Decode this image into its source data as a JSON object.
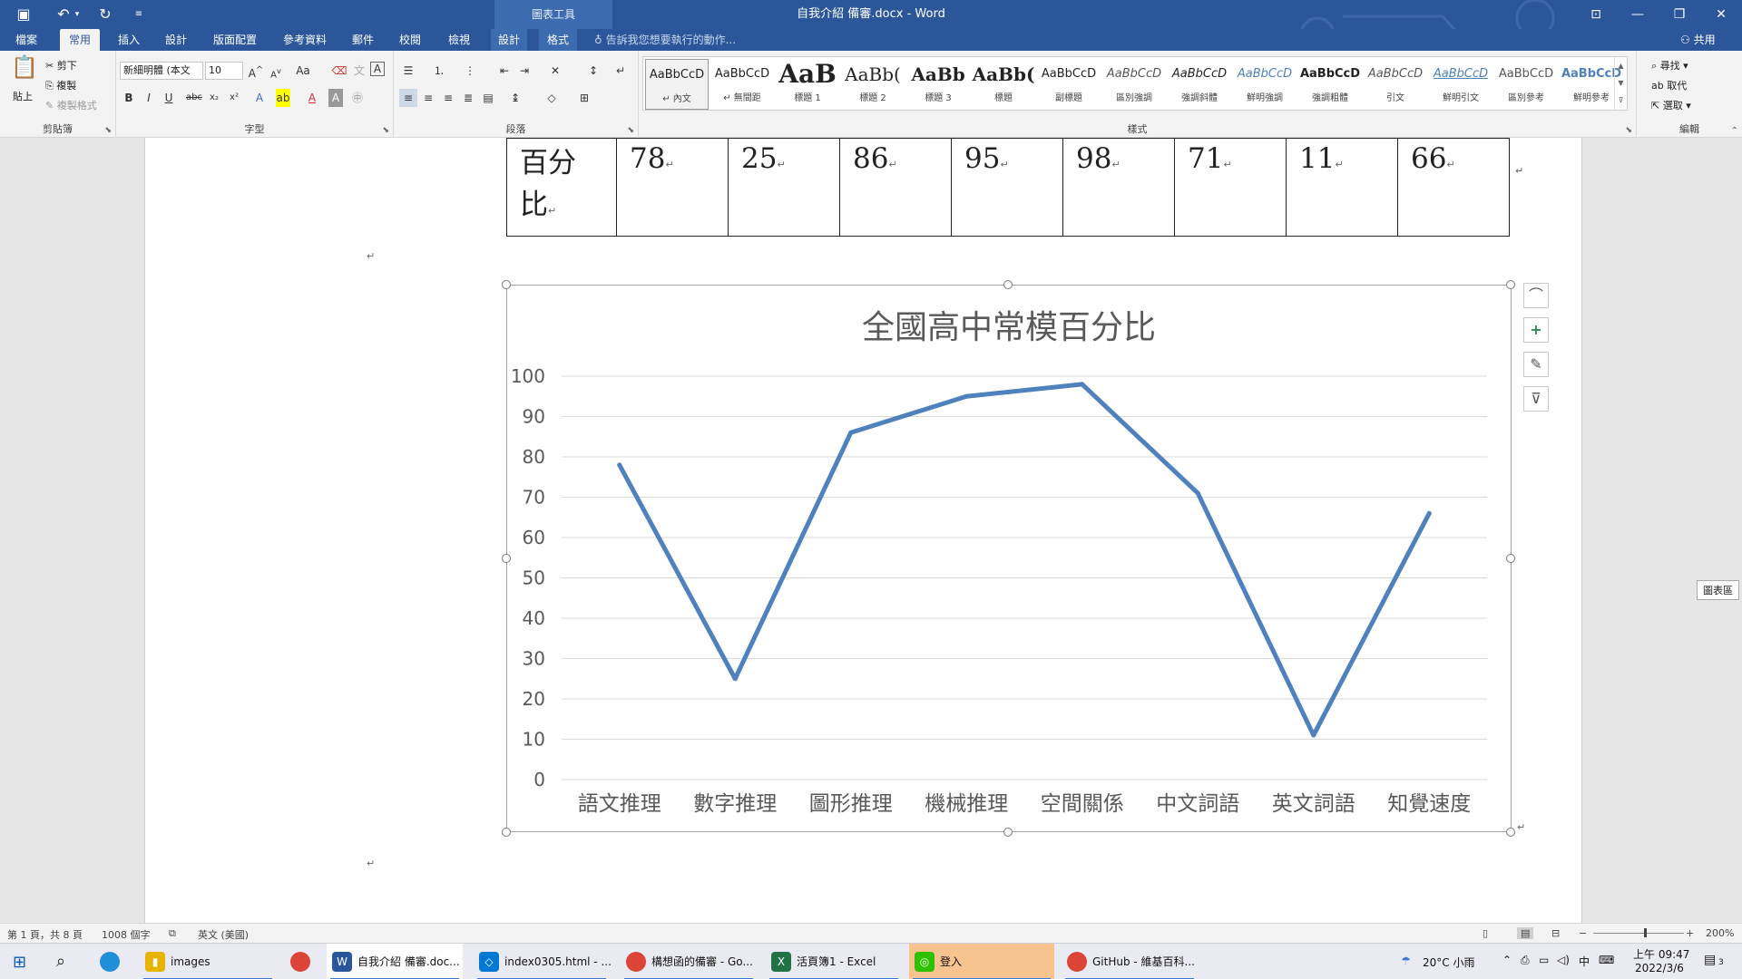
{
  "window": {
    "title": "自我介紹 備審.docx - Word",
    "context_tab_group": "圖表工具"
  },
  "tabs": [
    "檔案",
    "常用",
    "插入",
    "設計",
    "版面配置",
    "參考資料",
    "郵件",
    "校閱",
    "檢視",
    "設計",
    "格式"
  ],
  "active_tab": "常用",
  "tell_me": "告訴我您想要執行的動作...",
  "share": "共用",
  "ribbon": {
    "clipboard": {
      "label": "剪貼簿",
      "paste": "貼上",
      "cut": "剪下",
      "copy": "複製",
      "format_painter": "複製格式"
    },
    "font": {
      "label": "字型",
      "font_name": "新細明體 (本文",
      "font_size": "10"
    },
    "paragraph": {
      "label": "段落"
    },
    "styles": {
      "label": "樣式",
      "items": [
        {
          "sample": "AaBbCcD",
          "name": "↵ 內文"
        },
        {
          "sample": "AaBbCcD",
          "name": "↵ 無間距"
        },
        {
          "sample": "AaB",
          "name": "標題 1"
        },
        {
          "sample": "AaBb(",
          "name": "標題 2"
        },
        {
          "sample": "AaBb",
          "name": "標題 3"
        },
        {
          "sample": "AaBb(",
          "name": "標題"
        },
        {
          "sample": "AaBbCcD",
          "name": "副標題"
        },
        {
          "sample": "AaBbCcD",
          "name": "區別強調"
        },
        {
          "sample": "AaBbCcD",
          "name": "強調斜體"
        },
        {
          "sample": "AaBbCcD",
          "name": "鮮明強調"
        },
        {
          "sample": "AaBbCcD",
          "name": "強調粗體"
        },
        {
          "sample": "AaBbCcD",
          "name": "引文"
        },
        {
          "sample": "AaBbCcD",
          "name": "鮮明引文"
        },
        {
          "sample": "AaBbCcD",
          "name": "區別參考"
        },
        {
          "sample": "AaBbCcD",
          "name": "鮮明參考"
        }
      ]
    },
    "editing": {
      "label": "編輯",
      "find": "尋找",
      "replace": "取代",
      "select": "選取"
    }
  },
  "document": {
    "table_row": {
      "header": "百分比",
      "values": [
        "78",
        "25",
        "86",
        "95",
        "98",
        "71",
        "11",
        "66"
      ]
    }
  },
  "chart_data": {
    "type": "line",
    "title": "全國高中常模百分比",
    "categories": [
      "語文推理",
      "數字推理",
      "圖形推理",
      "機械推理",
      "空間關係",
      "中文詞語",
      "英文詞語",
      "知覺速度"
    ],
    "series": [
      {
        "values": [
          78,
          25,
          86,
          95,
          98,
          71,
          11,
          66
        ],
        "color": "#4f81bd"
      }
    ],
    "ylim": [
      0,
      100
    ],
    "yticks": [
      0,
      10,
      20,
      30,
      40,
      50,
      60,
      70,
      80,
      90,
      100
    ],
    "grid": true,
    "legend": "none"
  },
  "side_label": "圖表區",
  "statusbar": {
    "page": "第 1 頁，共 8 頁",
    "words": "1008 個字",
    "language": "英文 (美國)",
    "zoom": "200%"
  },
  "taskbar": {
    "apps": [
      {
        "label": "images",
        "color": "#e8b400",
        "glyph": "▮"
      },
      {
        "label": "",
        "color": "#db4437",
        "glyph": "●"
      },
      {
        "label": "自我介紹 備審.doc...",
        "color": "#2b579a",
        "glyph": "W"
      },
      {
        "label": "index0305.html - ...",
        "color": "#0078d4",
        "glyph": "◇"
      },
      {
        "label": "構想函的備審 - Go...",
        "color": "#db4437",
        "glyph": "●"
      },
      {
        "label": "活頁簿1 - Excel",
        "color": "#217346",
        "glyph": "X"
      },
      {
        "label": "登入",
        "color": "#2dc100",
        "glyph": "◎"
      },
      {
        "label": "GitHub - 維基百科...",
        "color": "#db4437",
        "glyph": "●"
      }
    ],
    "weather": "20°C 小雨",
    "ime": "中",
    "time": "上午 09:47",
    "date": "2022/3/6",
    "notifications": "3"
  }
}
